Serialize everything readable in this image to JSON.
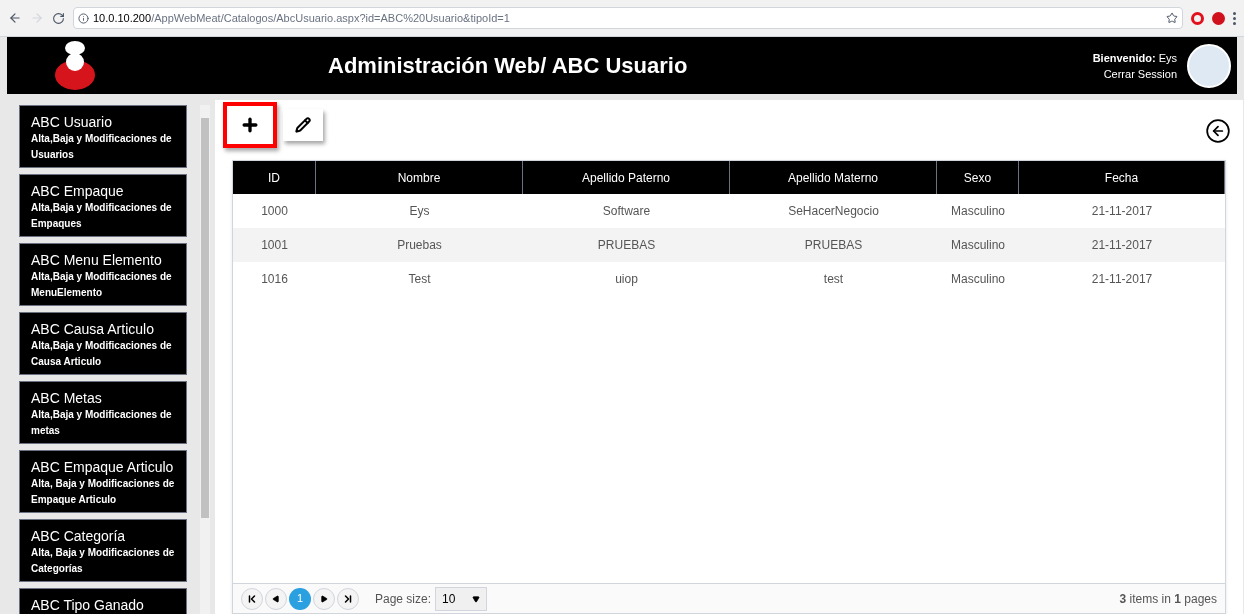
{
  "browser": {
    "url_host": "10.0.10.200",
    "url_path": "/AppWebMeat/Catalogos/AbcUsuario.aspx?id=ABC%20Usuario&tipoId=1"
  },
  "header": {
    "title": "Administración Web/ ABC Usuario",
    "welcome_label": "Bienvenido:",
    "user": "Eys",
    "logout": "Cerrar Session"
  },
  "sidebar": {
    "items": [
      {
        "title": "ABC Usuario",
        "description": "Alta,Baja y Modificaciones de Usuarios"
      },
      {
        "title": "ABC Empaque",
        "description": "Alta,Baja y Modificaciones de Empaques"
      },
      {
        "title": "ABC Menu Elemento",
        "description": "Alta,Baja y Modificaciones de MenuElemento"
      },
      {
        "title": "ABC Causa Articulo",
        "description": "Alta,Baja y Modificaciones de Causa Articulo"
      },
      {
        "title": "ABC Metas",
        "description": "Alta,Baja y Modificaciones de metas"
      },
      {
        "title": "ABC Empaque Articulo",
        "description": "Alta, Baja y Modificaciones de Empaque Articulo"
      },
      {
        "title": "ABC Categoría",
        "description": "Alta, Baja y Modificaciones de Categorías"
      },
      {
        "title": "ABC Tipo Ganado"
      }
    ]
  },
  "toolbar": {
    "buttons": [
      {
        "kind": "add",
        "highlighted": true
      },
      {
        "kind": "edit",
        "highlighted": false
      }
    ]
  },
  "table": {
    "columns": [
      "ID",
      "Nombre",
      "Apellido Paterno",
      "Apellido Materno",
      "Sexo",
      "Fecha"
    ],
    "rows": [
      [
        "1000",
        "Eys",
        "Software",
        "SeHacerNegocio",
        "Masculino",
        "21-11-2017"
      ],
      [
        "1001",
        "Pruebas",
        "PRUEBAS",
        "PRUEBAS",
        "Masculino",
        "21-11-2017"
      ],
      [
        "1016",
        "Test",
        "uiop",
        "test",
        "Masculino",
        "21-11-2017"
      ]
    ]
  },
  "pager": {
    "pages": [
      {
        "label": "1",
        "selected": true
      }
    ],
    "page_size_label": "Page size:",
    "page_size": "10",
    "summary": "**3** items in **1** pages"
  }
}
